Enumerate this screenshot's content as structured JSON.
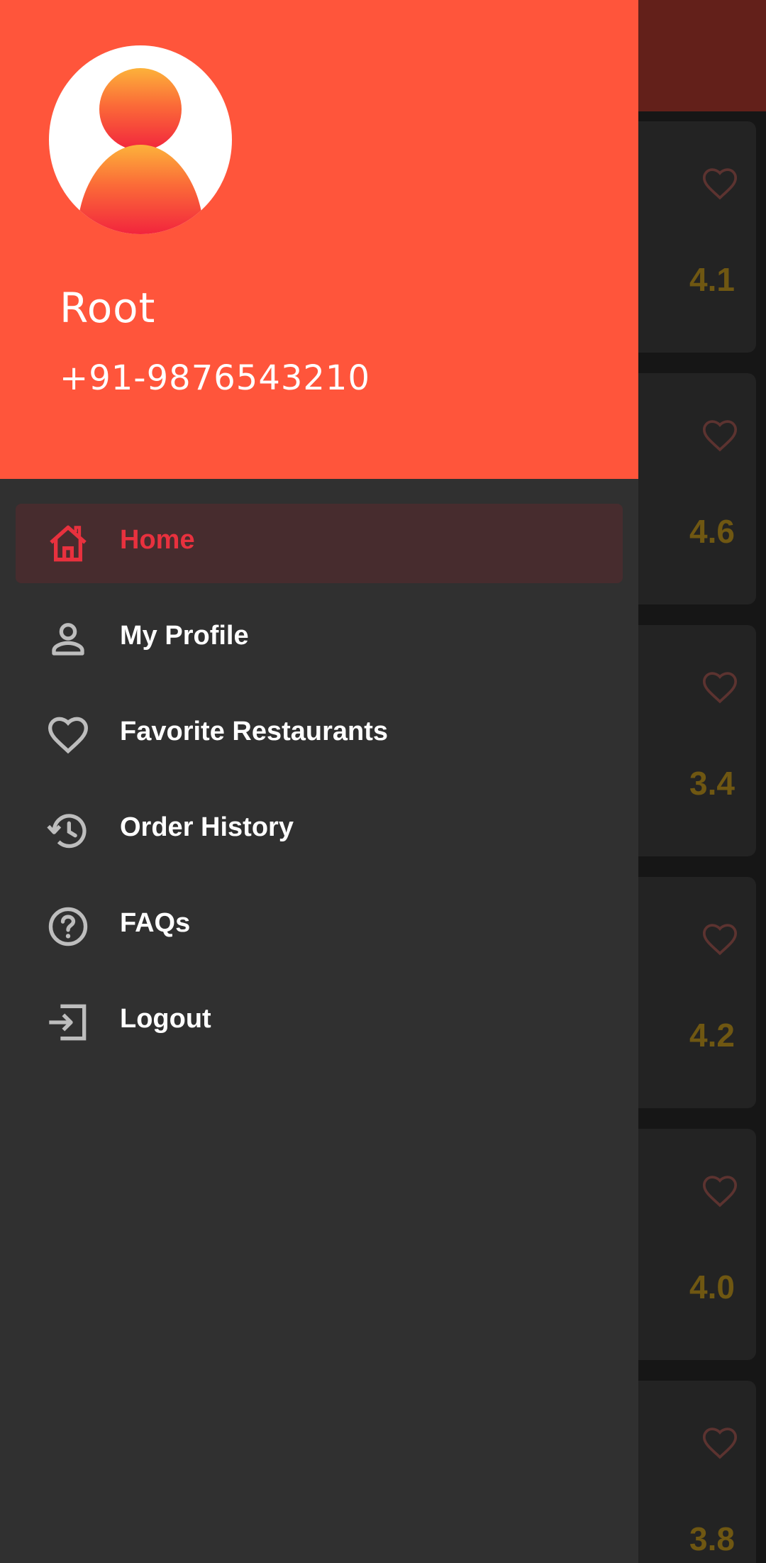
{
  "colors": {
    "header_bg": "#ff553b",
    "drawer_bg": "#303030",
    "active_item_bg": "#472c2e",
    "active_accent": "#e8313e",
    "icon_gray": "#bdbdbd",
    "rating_text": "#6f5712",
    "heart_dim": "#5c3330"
  },
  "drawer": {
    "header": {
      "avatar_icon": "user-avatar-icon",
      "name": "Root",
      "phone": "+91-9876543210"
    },
    "menu": [
      {
        "label": "Home",
        "icon": "home-icon",
        "active": true
      },
      {
        "label": "My Profile",
        "icon": "person-icon",
        "active": false
      },
      {
        "label": "Favorite Restaurants",
        "icon": "heart-icon",
        "active": false
      },
      {
        "label": "Order History",
        "icon": "history-icon",
        "active": false
      },
      {
        "label": "FAQs",
        "icon": "help-circle-icon",
        "active": false
      },
      {
        "label": "Logout",
        "icon": "login-icon",
        "active": false
      }
    ]
  },
  "background": {
    "restaurant_cards": [
      {
        "rating": "4.1",
        "icon": "heart-icon"
      },
      {
        "rating": "4.6",
        "icon": "heart-icon"
      },
      {
        "rating": "3.4",
        "icon": "heart-icon"
      },
      {
        "rating": "4.2",
        "icon": "heart-icon"
      },
      {
        "rating": "4.0",
        "icon": "heart-icon"
      },
      {
        "rating": "3.8",
        "icon": "heart-icon"
      }
    ]
  }
}
